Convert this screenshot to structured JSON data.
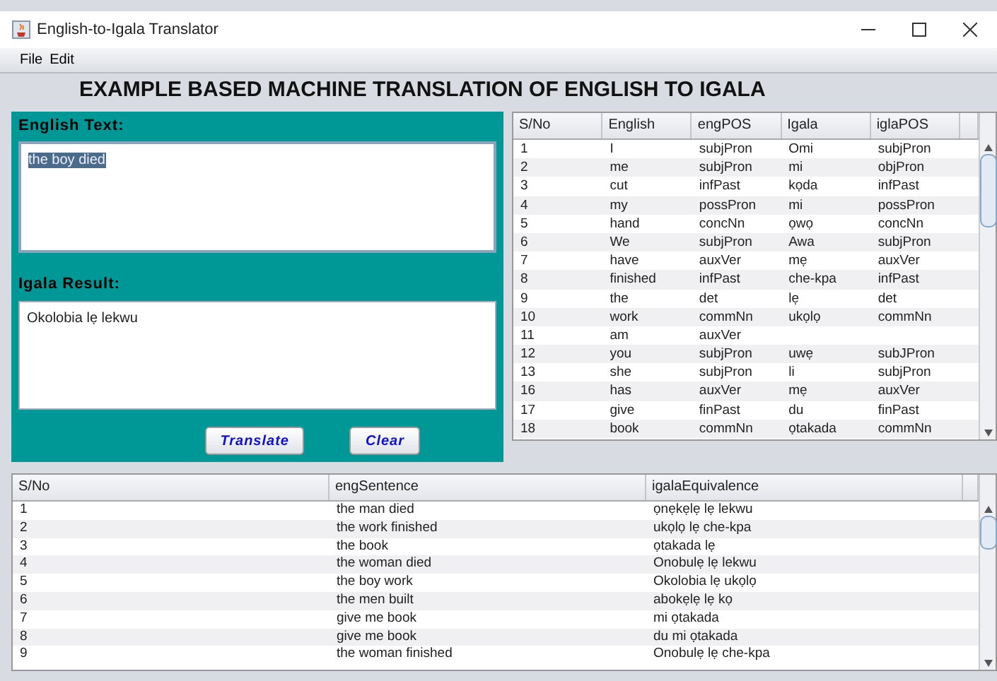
{
  "window": {
    "title": "English-to-Igala Translator"
  },
  "menu": [
    "File",
    "Edit"
  ],
  "heading": "EXAMPLE BASED MACHINE TRANSLATION OF ENGLISH TO IGALA",
  "input": {
    "label": "English Text:",
    "value": "the boy died",
    "text_selected": true
  },
  "result": {
    "label": "Igala Result:",
    "value": "Okolobia lẹ lekwu"
  },
  "buttons": [
    "Translate",
    "Clear"
  ],
  "word_table": {
    "columns": [
      "S/No",
      "English",
      "engPOS",
      "Igala",
      "iglaPOS"
    ],
    "rows": [
      [
        "1",
        "I",
        "subjPron",
        "Omi",
        "subjPron"
      ],
      [
        "2",
        "me",
        "subjPron",
        "mi",
        "objPron"
      ],
      [
        "3",
        "cut",
        "infPast",
        "kọda",
        "infPast"
      ],
      [
        "4",
        "my",
        "possPron",
        "mi",
        "possPron"
      ],
      [
        "5",
        "hand",
        "concNn",
        "ọwọ",
        "concNn"
      ],
      [
        "6",
        "We",
        "subjPron",
        "Awa",
        "subjPron"
      ],
      [
        "7",
        "have",
        "auxVer",
        "mẹ",
        "auxVer"
      ],
      [
        "8",
        "finished",
        "infPast",
        "che-kpa",
        "infPast"
      ],
      [
        "9",
        "the",
        "det",
        "lẹ",
        "det"
      ],
      [
        "10",
        "work",
        "commNn",
        "ukọlọ",
        "commNn"
      ],
      [
        "11",
        "am",
        "auxVer",
        "",
        ""
      ],
      [
        "12",
        "you",
        "subjPron",
        "uwẹ",
        "subJPron"
      ],
      [
        "13",
        "she",
        "subjPron",
        "li",
        "subjPron"
      ],
      [
        "16",
        "has",
        "auxVer",
        "mẹ",
        "auxVer"
      ],
      [
        "17",
        "give",
        "finPast",
        "du",
        "finPast"
      ],
      [
        "18",
        "book",
        "commNn",
        "ọtakada",
        "commNn"
      ]
    ]
  },
  "sentence_table": {
    "columns": [
      "S/No",
      "engSentence",
      "igalaEquivalence"
    ],
    "rows": [
      [
        "1",
        "the man died",
        "ọnẹkẹlẹ lẹ lekwu"
      ],
      [
        "2",
        "the work finished",
        "ukọlọ lẹ che-kpa"
      ],
      [
        "3",
        "the book",
        "ọtakada lẹ"
      ],
      [
        "4",
        "the woman died",
        "Onobulẹ lẹ lekwu"
      ],
      [
        "5",
        "the boy work",
        "Okolobia lẹ ukọlọ"
      ],
      [
        "6",
        "the men built",
        "abokẹlẹ lẹ kọ"
      ],
      [
        "7",
        "give me book",
        "mi ọtakada"
      ],
      [
        "8",
        "give me book",
        "du mi ọtakada"
      ],
      [
        "9",
        "the woman finished",
        "Onobulẹ lẹ che-kpa"
      ]
    ]
  }
}
